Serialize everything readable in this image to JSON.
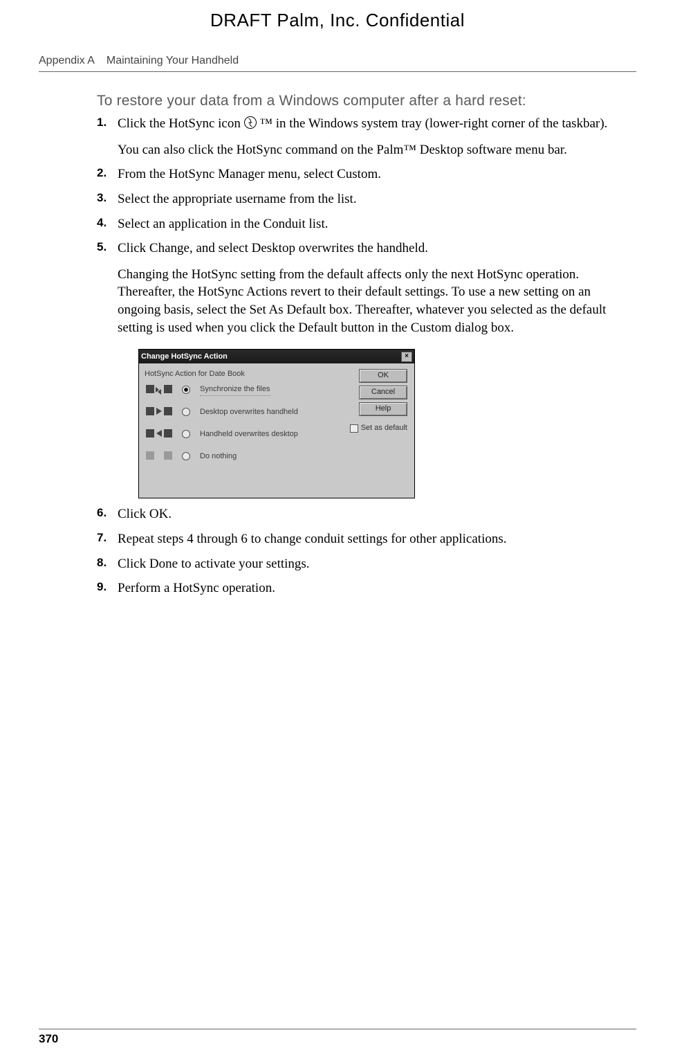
{
  "draft_banner": "DRAFT   Palm, Inc. Confidential",
  "header": {
    "appendix": "Appendix A",
    "section_title": "Maintaining Your Handheld"
  },
  "task_title": "To restore your data from a Windows computer after a hard reset:",
  "steps": [
    {
      "text_before_icon": "Click the HotSync icon ",
      "text_after_icon": "™ in the Windows system tray (lower-right corner of the taskbar).",
      "extra": "You can also click the HotSync command on the Palm™ Desktop software menu bar."
    },
    {
      "text": "From the HotSync Manager menu, select Custom."
    },
    {
      "text": "Select the appropriate username from the list."
    },
    {
      "text": "Select an application in the Conduit list."
    },
    {
      "text": "Click Change, and select Desktop overwrites the handheld.",
      "extra": "Changing the HotSync setting from the default affects only the next HotSync operation. Thereafter, the HotSync Actions revert to their default settings. To use a new setting on an ongoing basis, select the Set As Default box. Thereafter, whatever you selected as the default setting is used when you click the Default button in the Custom dialog box."
    },
    {
      "text": "Click OK."
    },
    {
      "text": "Repeat steps 4 through 6 to change conduit settings for other applications."
    },
    {
      "text": "Click Done to activate your settings."
    },
    {
      "text": "Perform a HotSync operation."
    }
  ],
  "dialog": {
    "title": "Change HotSync Action",
    "subtitle": "HotSync Action for Date Book",
    "options": {
      "sync": "Synchronize the files",
      "desktop_overwrites": "Desktop overwrites handheld",
      "handheld_overwrites": "Handheld overwrites desktop",
      "do_nothing": "Do nothing"
    },
    "buttons": {
      "ok": "OK",
      "cancel": "Cancel",
      "help": "Help"
    },
    "checkbox": "Set as default"
  },
  "page_number": "370"
}
